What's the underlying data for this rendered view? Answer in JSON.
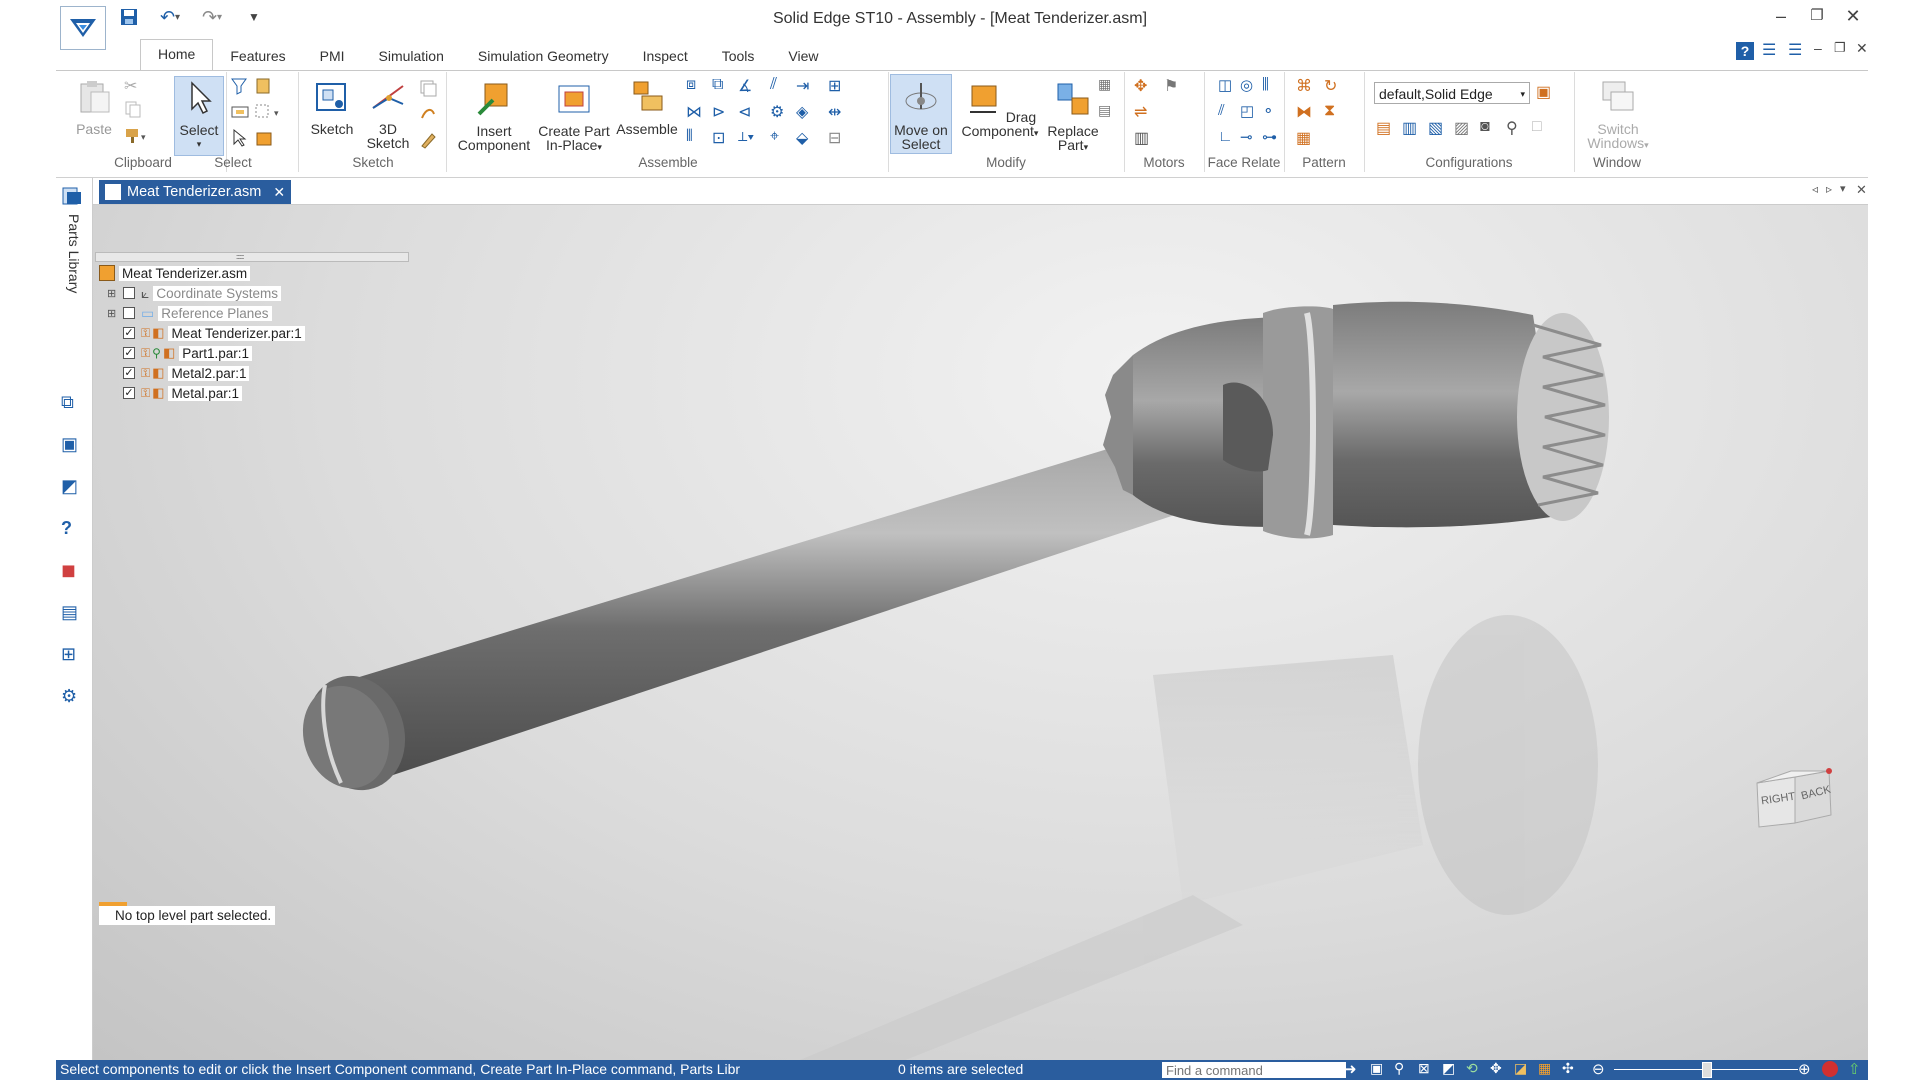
{
  "window": {
    "title": "Solid Edge ST10 - Assembly - [Meat Tenderizer.asm]"
  },
  "tabs": [
    "Home",
    "Features",
    "PMI",
    "Simulation",
    "Simulation Geometry",
    "Inspect",
    "Tools",
    "View"
  ],
  "ribbon": {
    "clipboard": {
      "paste": "Paste",
      "group": "Clipboard"
    },
    "select": {
      "select": "Select",
      "group": "Select"
    },
    "sketch": {
      "sketch": "Sketch",
      "sketch3d_1": "3D",
      "sketch3d_2": "Sketch",
      "group": "Sketch"
    },
    "assemble": {
      "insert_1": "Insert",
      "insert_2": "Component",
      "create_1": "Create Part",
      "create_2": "In-Place",
      "assemble": "Assemble",
      "group": "Assemble"
    },
    "modify": {
      "move_1": "Move on",
      "move_2": "Select",
      "drag_1": "Drag",
      "drag_2": "Component",
      "replace_1": "Replace",
      "replace_2": "Part",
      "group": "Modify"
    },
    "motors": {
      "group": "Motors"
    },
    "face_relate": {
      "group": "Face Relate"
    },
    "pattern": {
      "group": "Pattern"
    },
    "configurations": {
      "value": "default,Solid Edge",
      "group": "Configurations"
    },
    "window": {
      "switch_1": "Switch",
      "switch_2": "Windows",
      "group": "Window"
    }
  },
  "document_tab": "Meat Tenderizer.asm",
  "sidebar": {
    "parts_library": "Parts Library"
  },
  "tree": {
    "root": "Meat Tenderizer.asm",
    "items": [
      {
        "label": "Coordinate Systems",
        "checked": false
      },
      {
        "label": "Reference Planes",
        "checked": false
      },
      {
        "label": "Meat Tenderizer.par:1",
        "checked": true
      },
      {
        "label": "Part1.par:1",
        "checked": true
      },
      {
        "label": "Metal2.par:1",
        "checked": true
      },
      {
        "label": "Metal.par:1",
        "checked": true
      }
    ]
  },
  "viewport": {
    "message": "No top level part selected.",
    "viewcube_right": "RIGHT",
    "viewcube_back": "BACK"
  },
  "status": {
    "prompt": "Select components to edit or click the Insert Component command, Create Part In-Place command, Parts Libr",
    "selection": "0 items are selected",
    "command_placeholder": "Find a command"
  },
  "colors": {
    "accent": "#2a5d9e",
    "model": "#7a7a7a"
  }
}
